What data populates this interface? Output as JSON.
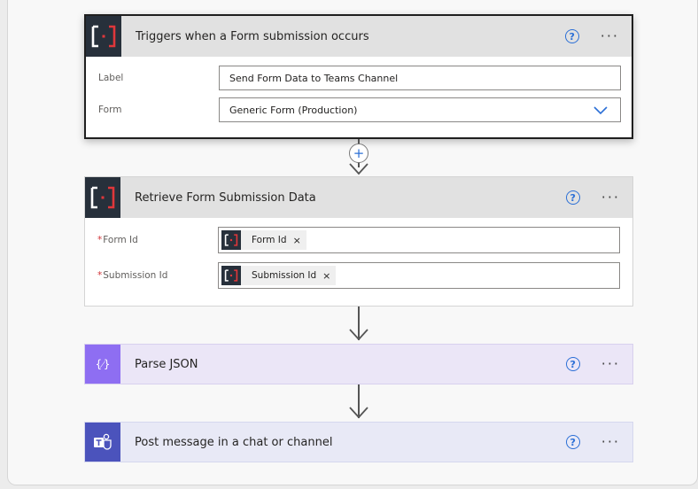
{
  "steps": {
    "trigger": {
      "title": "Triggers when a Form submission occurs",
      "fields": {
        "label": {
          "label": "Label",
          "value": "Send Form Data to Teams Channel"
        },
        "form": {
          "label": "Form",
          "value": "Generic Form (Production)"
        }
      },
      "help": "?",
      "more": "···"
    },
    "retrieve": {
      "title": "Retrieve Form Submission Data",
      "fields": {
        "form_id": {
          "required_mark": "*",
          "label": "Form Id",
          "token": "Form Id",
          "remove": "×"
        },
        "submission_id": {
          "required_mark": "*",
          "label": "Submission Id",
          "token": "Submission Id",
          "remove": "×"
        }
      },
      "help": "?",
      "more": "···"
    },
    "parse": {
      "title": "Parse JSON",
      "icon_glyph": "{⁄}",
      "help": "?",
      "more": "···"
    },
    "post": {
      "title": "Post message in a chat or channel",
      "help": "?",
      "more": "···"
    }
  },
  "connector": {
    "insert_label": "+"
  },
  "colors": {
    "connector_tile": "#27303b",
    "connector_accent": "#e0373b",
    "parse_tile": "#8e6ef2",
    "teams_tile": "#4b53bc",
    "help_blue": "#2b6fd6",
    "required_red": "#d13438"
  },
  "icons": [
    "connector-logo-icon",
    "help-icon",
    "more-icon",
    "chevron-down-icon",
    "plus-icon",
    "arrow-down-icon",
    "parse-json-icon",
    "teams-icon",
    "remove-token-icon"
  ]
}
